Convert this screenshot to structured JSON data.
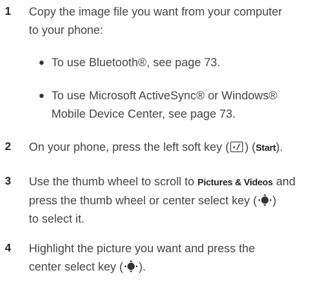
{
  "steps": [
    {
      "number": "1",
      "line1": "Copy the image file you want from your computer",
      "line2": "to your phone:"
    },
    {
      "number": "2",
      "pre": "On your phone, press the left soft key (",
      "mid": ") (",
      "key_label": "Start",
      "post": ")."
    },
    {
      "number": "3",
      "line1_pre": "Use the thumb wheel to scroll to ",
      "line1_key": "Pictures & Videos",
      "line1_post": " and",
      "line2_pre": "press the thumb wheel or center select key (",
      "line2_post": ")",
      "line3": "to select it."
    },
    {
      "number": "4",
      "line1": "Highlight the picture you want and press the",
      "line2_pre": "center select key (",
      "line2_post": ")."
    }
  ],
  "bullets": [
    {
      "line1": "To use Bluetooth®, see page 73."
    },
    {
      "line1": "To use Microsoft ActiveSync® or Windows®",
      "line2": "Mobile Device Center, see page 73."
    }
  ],
  "icons": {
    "soft_key": "left-soft-key-icon",
    "center_select": "center-select-key-icon"
  },
  "colors": {
    "text": "#444444",
    "number": "#222222"
  }
}
